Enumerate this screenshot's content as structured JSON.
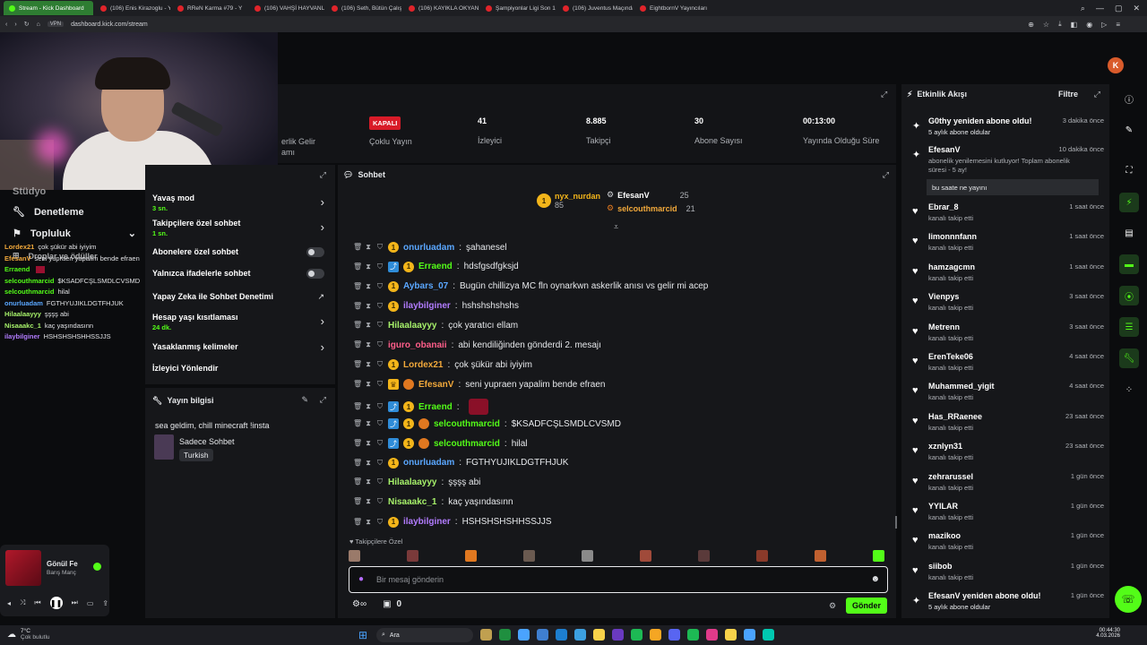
{
  "browser": {
    "tabs": [
      {
        "label": "Stream - Kick Dashboard",
        "active": true
      },
      {
        "label": "(106) Enis Kirazoglu - You",
        "active": false
      },
      {
        "label": "RReN Karma #79 - Y",
        "active": false
      },
      {
        "label": "(106) VAHŞİ HAYVANLAR",
        "active": false
      },
      {
        "label": "(106) Seth, Bütün Çalışan",
        "active": false
      },
      {
        "label": "(106) KAYIKLA OKYANUS",
        "active": false
      },
      {
        "label": "Şampiyonlar Ligi Son 16 P",
        "active": false
      },
      {
        "label": "(106) Juventus Maçından",
        "active": false
      },
      {
        "label": "EightbornV Yayıncıları",
        "active": false
      }
    ],
    "url": "dashboard.kick.com/stream",
    "badge": "VPN"
  },
  "stats": {
    "status_badge": "KAPALI",
    "status_label": "Çoklu Yayın",
    "partial_label_1": "erlik Gelir",
    "partial_label_2": "amı",
    "viewers_value": "41",
    "viewers_label": "İzleyici",
    "followers_value": "8.885",
    "followers_label": "Takipçi",
    "subs_value": "30",
    "subs_label": "Abone Sayısı",
    "uptime_value": "00:13:00",
    "uptime_label": "Yayında Olduğu Süre"
  },
  "sidebar": {
    "item_partial": "Stüdyo",
    "moderation": "Denetleme",
    "community": "Topluluk",
    "drops": "Droplar ve ödüller"
  },
  "mini_chat": [
    {
      "user": "Lordex21",
      "text": "çok şükür abi iyiyim",
      "color": "#f2a93b"
    },
    {
      "user": "EfesanV",
      "text": "seni yupraen yapalim bende efraen",
      "color": "#f2a93b"
    },
    {
      "user": "Erraend",
      "text": "",
      "color": "#53fc18"
    },
    {
      "user": "selcouthmarcid",
      "text": "$KSADFCŞLSMDLCVSMD",
      "color": "#53fc18"
    },
    {
      "user": "selcouthmarcid",
      "text": "hilal",
      "color": "#53fc18"
    },
    {
      "user": "onurluadam",
      "text": "FGTHYUJIKLDGTFHJUK",
      "color": "#5aa7ff"
    },
    {
      "user": "Hilaalaayyy",
      "text": "şşşş abi",
      "color": "#a6f06a"
    },
    {
      "user": "Nisaaakc_1",
      "text": "kaç yaşındasınn",
      "color": "#a6f06a"
    },
    {
      "user": "ilaybilginer",
      "text": "HSHSHSHSHHSSJJS",
      "color": "#b27cff"
    }
  ],
  "mod_settings": [
    {
      "title": "Yavaş mod",
      "sub": "3 sn.",
      "control": "chevron"
    },
    {
      "title": "Takipçilere özel sohbet",
      "sub": "1 sn.",
      "control": "chevron"
    },
    {
      "title": "Abonelere özel sohbet",
      "sub": "",
      "control": "toggle"
    },
    {
      "title": "Yalnızca ifadelerle sohbet",
      "sub": "",
      "control": "toggle"
    },
    {
      "title": "Yapay Zeka ile Sohbet Denetimi",
      "sub": "",
      "control": "external"
    },
    {
      "title": "Hesap yaşı kısıtlaması",
      "sub": "24 dk.",
      "control": "chevron"
    },
    {
      "title": "Yasaklanmış kelimeler",
      "sub": "",
      "control": "chevron"
    },
    {
      "title": "İzleyici Yönlendir",
      "sub": "",
      "control": "none"
    }
  ],
  "stream_info": {
    "header": "Yayın bilgisi",
    "title": "sea geldim, chill minecraft !insta",
    "category": "Sadece Sohbet",
    "language": "Turkish"
  },
  "chat": {
    "header": "Sohbet",
    "leaderboard": [
      {
        "name": "nyx_nurdan",
        "count": "85"
      },
      {
        "name": "EfesanV",
        "count": "25"
      },
      {
        "name": "selcouthmarcid",
        "count": "21"
      }
    ],
    "messages": [
      {
        "user": "onurluadam",
        "text": "şahanesel",
        "color": "#5aa7ff",
        "badges": [
          "sub"
        ]
      },
      {
        "user": "Erraend",
        "text": "hdsfgsdfgksjd",
        "color": "#53fc18",
        "badges": [
          "vip",
          "sub"
        ]
      },
      {
        "user": "Aybars_07",
        "text": "Bugün chillizya MC fln oynarkwn askerlik anısı vs gelir mi acep",
        "color": "#5aa7ff",
        "badges": [
          "sub"
        ]
      },
      {
        "user": "ilaybilginer",
        "text": "hshshshshshs",
        "color": "#b27cff",
        "badges": [
          "sub"
        ]
      },
      {
        "user": "Hilaalaayyy",
        "text": "çok yaratıcı ellam",
        "color": "#a6f06a",
        "badges": []
      },
      {
        "user": "iguro_obanaii",
        "text": "abi kendiliğinden gönderdi 2. mesajı",
        "color": "#ff5e8a",
        "badges": []
      },
      {
        "user": "Lordex21",
        "text": "çok şükür abi iyiyim",
        "color": "#f2a93b",
        "badges": [
          "sub"
        ]
      },
      {
        "user": "EfesanV",
        "text": "seni yupraen yapalim bende efraen",
        "color": "#f2a93b",
        "badges": [
          "crown",
          "og"
        ]
      },
      {
        "user": "Erraend",
        "text": "",
        "color": "#53fc18",
        "badges": [
          "vip",
          "sub"
        ]
      },
      {
        "user": "selcouthmarcid",
        "text": "$KSADFCŞLSMDLCVSMD",
        "color": "#53fc18",
        "badges": [
          "vip",
          "sub",
          "og"
        ]
      },
      {
        "user": "selcouthmarcid",
        "text": "hilal",
        "color": "#53fc18",
        "badges": [
          "vip",
          "sub",
          "og"
        ]
      },
      {
        "user": "onurluadam",
        "text": "FGTHYUJIKLDGTFHJUK",
        "color": "#5aa7ff",
        "badges": [
          "sub"
        ]
      },
      {
        "user": "Hilaalaayyy",
        "text": "şşşş abi",
        "color": "#a6f06a",
        "badges": []
      },
      {
        "user": "Nisaaakc_1",
        "text": "kaç yaşındasınn",
        "color": "#a6f06a",
        "badges": []
      },
      {
        "user": "ilaybilginer",
        "text": "HSHSHSHSHHSSJJS",
        "color": "#b27cff",
        "badges": [
          "sub"
        ]
      }
    ],
    "followers_only": "Takipçilere Özel",
    "input_placeholder": "Bir mesaj gönderin",
    "points": "0",
    "send": "Gönder"
  },
  "events": {
    "header": "Etkinlik Akışı",
    "filter": "Filtre",
    "items": [
      {
        "name": "G0thy yeniden abone oldu!",
        "detail": "5 aylık abone oldular",
        "time": "3 dakika önce",
        "type": "sub"
      },
      {
        "name": "EfesanV",
        "detail": "abonelik yenilemesini kutluyor! Toplam abonelik süresi - 5 ay!",
        "time": "10 dakika önce",
        "type": "resub",
        "message": "bu saate ne yayını"
      },
      {
        "name": "Ebrar_8",
        "detail": "kanalı takip etti",
        "time": "1 saat önce",
        "type": "follow"
      },
      {
        "name": "limonnnfann",
        "detail": "kanalı takip etti",
        "time": "1 saat önce",
        "type": "follow"
      },
      {
        "name": "hamzagcmn",
        "detail": "kanalı takip etti",
        "time": "1 saat önce",
        "type": "follow"
      },
      {
        "name": "Vienpys",
        "detail": "kanalı takip etti",
        "time": "3 saat önce",
        "type": "follow"
      },
      {
        "name": "Metrenn",
        "detail": "kanalı takip etti",
        "time": "3 saat önce",
        "type": "follow"
      },
      {
        "name": "ErenTeke06",
        "detail": "kanalı takip etti",
        "time": "4 saat önce",
        "type": "follow"
      },
      {
        "name": "Muhammed_yigit",
        "detail": "kanalı takip etti",
        "time": "4 saat önce",
        "type": "follow"
      },
      {
        "name": "Has_RRaenee",
        "detail": "kanalı takip etti",
        "time": "23 saat önce",
        "type": "follow"
      },
      {
        "name": "xznlyn31",
        "detail": "kanalı takip etti",
        "time": "23 saat önce",
        "type": "follow"
      },
      {
        "name": "zehrarussel",
        "detail": "kanalı takip etti",
        "time": "1 gün önce",
        "type": "follow"
      },
      {
        "name": "YYILAR",
        "detail": "kanalı takip etti",
        "time": "1 gün önce",
        "type": "follow"
      },
      {
        "name": "mazikoo",
        "detail": "kanalı takip etti",
        "time": "1 gün önce",
        "type": "follow"
      },
      {
        "name": "siibob",
        "detail": "kanalı takip etti",
        "time": "1 gün önce",
        "type": "follow"
      },
      {
        "name": "EfesanV yeniden abone oldu!",
        "detail": "5 aylık abone oldular",
        "time": "1 gün önce",
        "type": "sub"
      }
    ]
  },
  "music": {
    "title": "Gönül Fe",
    "artist": "Barış Manç"
  },
  "taskbar": {
    "weather": "7°C",
    "weather_desc": "Çok bulutlu",
    "search": "Ara",
    "time": "00:44:30",
    "date": "4.03.2026"
  },
  "colors": {
    "accent": "#53fc18",
    "live_red": "#d81b28",
    "panel": "#16171a",
    "bg": "#0b0c0e"
  }
}
